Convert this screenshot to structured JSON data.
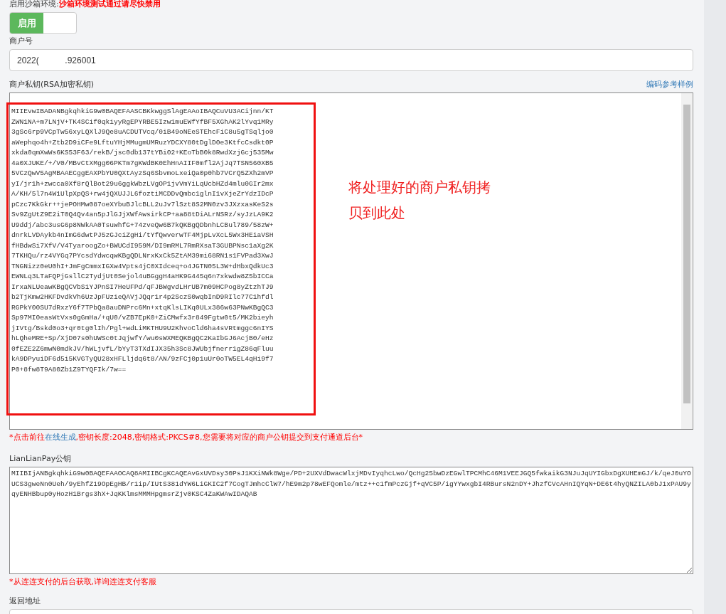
{
  "sandbox": {
    "label": "启用沙箱环境:",
    "warning": "沙箱环境测试通过请尽快禁用",
    "switch": {
      "label": "启用",
      "on": true
    }
  },
  "merchant_id": {
    "label": "商户号",
    "value": "2022(           .926001"
  },
  "private_key": {
    "label": "商户私钥(RSA加密私钥)",
    "link": "编码参考样例",
    "value": "MIIEvwIBADANBgkqhkiG9w0BAQEFAASCBKkwggSlAgEAAoIBAQCuVU3ACijnn/KT\nZWN1NA+m7LNjV+TK4SCif0qkiyyRgEPYRBE5Izw1muEWfYfBF5XGhAK2lYvq1MRy\n3gSc6rp9VCpTw56xyLQXlJ9Qe8uACDUTVcq/0iB49oNEeSTEhcFiC8u5gTSqljo0\naWephqo4h+Ztb2D9iCFe9LftuYHjMMugmUMRuzYDCXY80tDglD0e3KtfcCsdkt0P\nxkda0qmXwWs6KS53F63/rekB/jsc0db137tYBi02+KEoTbB0k8RwdXzjGcj535Mw\n4a0XJUKE/+/V0/MBvCtXMgg06PKTm7gKWdBK0EhHnAIIF0mfl2AjJq7TSN560XB5\n5VCzQwV5AgMBAAECggEAXPbYU0QXtAyzSq6SbvmoLxeiQa0p0hb7VCrQ5ZXh2mVP\nyI/jr1h+zwcca0Xf8rQlBot29u6ggkWbzLVgOP1jvVmYiLqUcbHZd4mlu0GIr2mx\nA/KH/5l7n4W1UlpXpQS+rw4jQXUJJL6foztiMCDDvQmbc1glnI1vXjeZrYdzIDcP\npCzc7KkGkr++jePOHMw087oeXYbuBJlcBLL2uJv7lSzt8S2MN0zv3JXzxasKeS2s\nSv9ZgUtZ9E2iT0Q4Qv4an5pJlGJjXWfAwsirkCP+aa88tDiALrNSRz/syJzLA9K2\nU9ddj/abc3usG6p8NWkAA0TsuwhfG+74zveQw6B7kQKBgQDbnhLCBul789/58zW+\ndnrkLVDAykb4nImG6dwtPJ5zGJciZgHi/tYfQwverwTF4MjpLvXcL5Wx3HEiaVSH\nfHBdwSi7XfV/V4TyaroogZo+BWUCdI959M/DI9mRML7RmRXsaT3GUBPNsc1aXg2K\n7TKHQu/rz4VYGq7PYcsdYdwcqwKBgQDLNrxKxCk5ZtAM39mi68RN1s1FVPad3XwJ\nTNGNizz0eU0hI+JmFgCmmxIGXw4Vpts4jC0XIdceq+o4JGTN05L3W+dHbxQdkUc3\nEWNLq3LTaFQPjGsllC2TydjUt0Sejol4uBGggH4aHK9G445q6n7xkwdw8Z5bICCa\nIrxaNLUeawKBgQCVbS1YJPnSI7HeUFPd/qFJBWgvdLHrUB7m09HCPog8yZtzhTJ9\nb2TjKmw2HKFDvdkVh6UzJpFUzieQAVjJQqr1r4p2SczS0wqbInD9RIlc77C1hfdl\nRGPkY00SU7dRxzY6f7TPbQa8auDNPrc6Mn+xtqKlsLIKq0ULx386w63PNwKBgQC3\nSp97MI0easWtVxs0gGmHa/+qU0/vZB7EpK0+ZiCMwfx3r849Fgtw0t5/MK2bieyh\njIVtg/Bskd0o3+qr0tg0lIh/Pgl+wdLiMKTHU9U2KhvoCld6ha4sVRtmggc6nIYS\nhLQheMRE+Sp/XjD07s0hUWSc0tJqjwfY/wu0sWXMEQKBgQC2KaIbGJ6AcjB0/eHz\n0fEZE2Z6mwN0mdkJV/hWLjvfL/bYyT3TXdIJX35h3Sc8JWUbjfnerr1gZ86qFluu\nkA9DPyuiDF6d5i5KVGTyQU28xHFLljdq6t8/AN/9zFCj0p1uUr0oTW5EL4qHi9f7\nP0+8fw8T9A80Zb1Z9TYQFIk/7w==",
    "annotation": "将处理好的商户私钥拷贝到此处",
    "note": {
      "prefix": "*点击前往",
      "link": "在线生成",
      "suffix": ",密钥长度:2048,密钥格式:PKCS#8,您需要将对应的商户公钥提交到支付通道后台*"
    }
  },
  "public_key": {
    "label": "LianLianPay公钥",
    "value": "MIIBIjANBgkqhkiG9w0BAQEFAAOCAQ8AMIIBCgKCAQEAvGxUVDsy30PsJ1KXiNWk8Wge/PD+2UXVdDwacWlxjMDvIyqhcLwo/QcHg25bwDzEGwlTPCMhC46M1VEEJGQ5fwkaikG3NJuJqUYIGbxDgXUHEmGJ/k/qeJ0uYOUCS3gweNn0Ueh/9yEhfZ19OpEgHB/r1ip/IUtS381dYW6LiGKIC2f7CogTJmhcClW7/hE9m2p78wEFQomle/mtz++c1fmPczGjf+qVC5P/igYYwxgbI4RBursN2nDY+JhzfCVcAHnIQYqN+DE6t4hyQNZILA0bJ1xPAU9yqyENHBbup0yHozH1Brgs3hX+JqKKlmsMMMHpgmsrZjv0KSC4ZaKWAwIDAQAB",
    "note": "*从连连支付的后台获取,详询连连支付客服"
  },
  "return_url": {
    "label": "返回地址"
  }
}
